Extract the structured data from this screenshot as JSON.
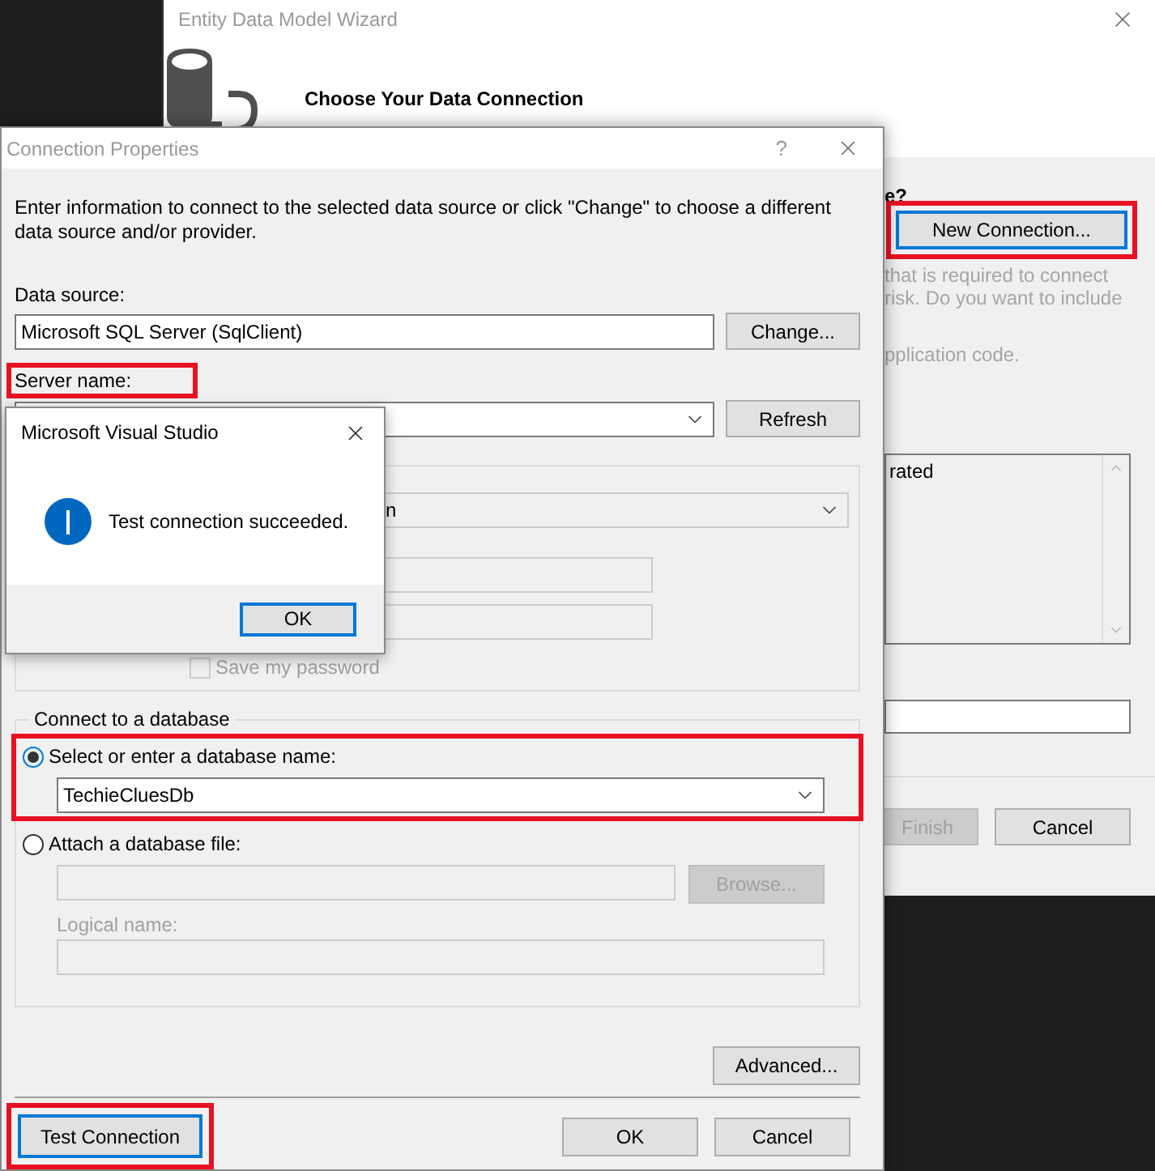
{
  "wizard": {
    "title": "Entity Data Model Wizard",
    "heading": "Choose Your Data Connection",
    "question": "e?",
    "new_connection_button": {
      "label": "New Connection...",
      "highlighted": true
    },
    "description_lines": [
      "that is required to connect",
      "risk. Do you want to include",
      "pplication code."
    ],
    "connection_string_text": "rated",
    "footer_buttons": [
      {
        "label": "Finish",
        "disabled": true
      },
      {
        "label": "Cancel",
        "disabled": false
      }
    ]
  },
  "connection_properties": {
    "title": "Connection Properties",
    "help": "?",
    "intro": "Enter information to connect to the selected data source or click \"Change\" to choose a different data source and/or provider.",
    "data_source": {
      "label": "Data source:",
      "value": "Microsoft SQL Server (SqlClient)",
      "button": "Change..."
    },
    "server_name": {
      "label": "Server name:",
      "highlighted": true,
      "button": "Refresh"
    },
    "log_on": {
      "authentication_value": "n",
      "save_password": {
        "label": "Save my password",
        "checked": false,
        "disabled": true
      }
    },
    "database": {
      "group_title": "Connect to a database",
      "options": [
        {
          "label": "Select or enter a database name:",
          "selected": true,
          "highlighted": true,
          "value": "TechieCluesDb"
        },
        {
          "label": "Attach a database file:",
          "selected": false,
          "highlighted": false,
          "button": "Browse...",
          "sub_label": "Logical name:"
        }
      ]
    },
    "advanced_button": "Advanced...",
    "footer_buttons": [
      {
        "label": "Test Connection",
        "focused": true,
        "highlighted": true
      },
      {
        "label": "OK",
        "focused": false,
        "highlighted": false
      },
      {
        "label": "Cancel",
        "focused": false,
        "highlighted": false
      }
    ]
  },
  "message_box": {
    "title": "Microsoft Visual Studio",
    "message": "Test connection succeeded.",
    "button": "OK"
  }
}
